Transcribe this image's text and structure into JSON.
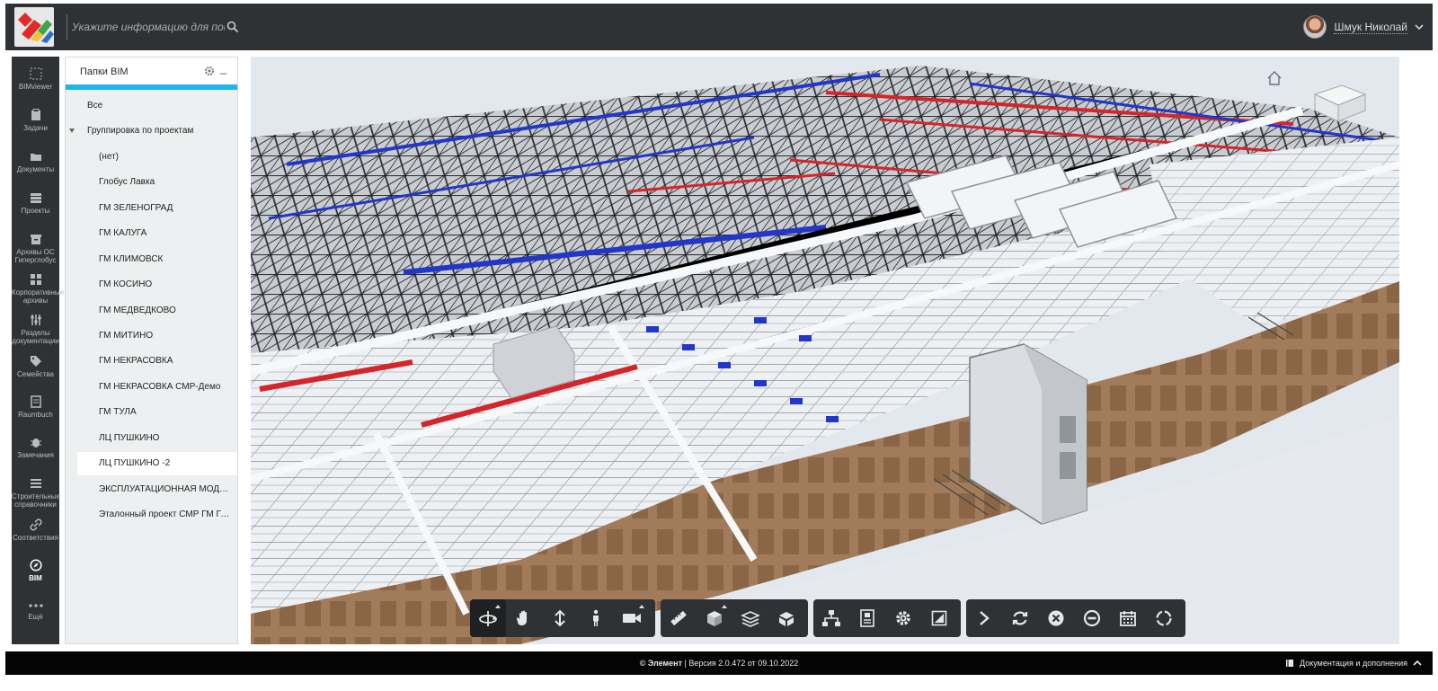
{
  "header": {
    "search_placeholder": "Укажите информацию для поиска",
    "user_name": "Шмук Николай"
  },
  "nav": {
    "items": [
      {
        "label": "BIMviewer",
        "icon": "bimviewer-icon"
      },
      {
        "label": "Задачи",
        "icon": "tasks-icon"
      },
      {
        "label": "Документы",
        "icon": "documents-icon"
      },
      {
        "label": "Проекты",
        "icon": "projects-icon"
      },
      {
        "label": "Архивы ОС Гиперглобус",
        "icon": "archive-icon"
      },
      {
        "label": "Корпоративные архивы",
        "icon": "corporate-archive-icon"
      },
      {
        "label": "Разделы документации",
        "icon": "doc-sections-icon"
      },
      {
        "label": "Семейства",
        "icon": "families-icon"
      },
      {
        "label": "Raumbuch",
        "icon": "raumbuch-icon"
      },
      {
        "label": "Замечания",
        "icon": "remarks-icon"
      },
      {
        "label": "Строительные справочники",
        "icon": "references-icon"
      },
      {
        "label": "Соответствия",
        "icon": "link-icon"
      },
      {
        "label": "BIM",
        "icon": "bim-icon"
      },
      {
        "label": "Ещё",
        "icon": "more-icon"
      }
    ]
  },
  "tree": {
    "title": "Папки BIM",
    "minimize": "_",
    "items": [
      {
        "label": "Все",
        "level": 0
      },
      {
        "label": "Группировка по проектам",
        "level": 0,
        "expanded": true
      },
      {
        "label": "(нет)",
        "level": 1
      },
      {
        "label": "Глобус Лавка",
        "level": 1
      },
      {
        "label": "ГМ ЗЕЛЕНОГРАД",
        "level": 1
      },
      {
        "label": "ГМ КАЛУГА",
        "level": 1
      },
      {
        "label": "ГМ КЛИМОВСК",
        "level": 1
      },
      {
        "label": "ГМ КОСИНО",
        "level": 1
      },
      {
        "label": "ГМ МЕДВЕДКОВО",
        "level": 1
      },
      {
        "label": "ГМ МИТИНО",
        "level": 1
      },
      {
        "label": "ГМ НЕКРАСОВКА",
        "level": 1
      },
      {
        "label": "ГМ НЕКРАСОВКА СМР-Демо",
        "level": 1
      },
      {
        "label": "ГМ ТУЛА",
        "level": 1
      },
      {
        "label": "ЛЦ ПУШКИНО",
        "level": 1
      },
      {
        "label": "ЛЦ ПУШКИНО -2",
        "level": 1,
        "selected": true
      },
      {
        "label": "ЭКСПЛУАТАЦИОННАЯ МОДЕ...",
        "level": 1
      },
      {
        "label": "Эталонный проект СМР ГМ Гл...",
        "level": 1
      }
    ]
  },
  "toolbar": {
    "groups": [
      [
        "orbit-icon",
        "pan-hand-icon",
        "zoom-updown-icon",
        "walk-person-icon",
        "camera-icon"
      ],
      [
        "measure-ruler-icon",
        "section-box-icon",
        "layers-icon",
        "explode-model-icon"
      ],
      [
        "model-tree-icon",
        "properties-icon",
        "settings-gear-icon",
        "fit-view-icon"
      ],
      [
        "chevron-right-icon",
        "refresh-icon",
        "close-circle-icon",
        "minus-circle-icon",
        "calendar-icon",
        "reset-view-icon"
      ]
    ]
  },
  "footer": {
    "brand": "© Элемент",
    "version": "Версия 2.0.472 от 09.10.2022",
    "docs": "Документация и дополнения"
  }
}
